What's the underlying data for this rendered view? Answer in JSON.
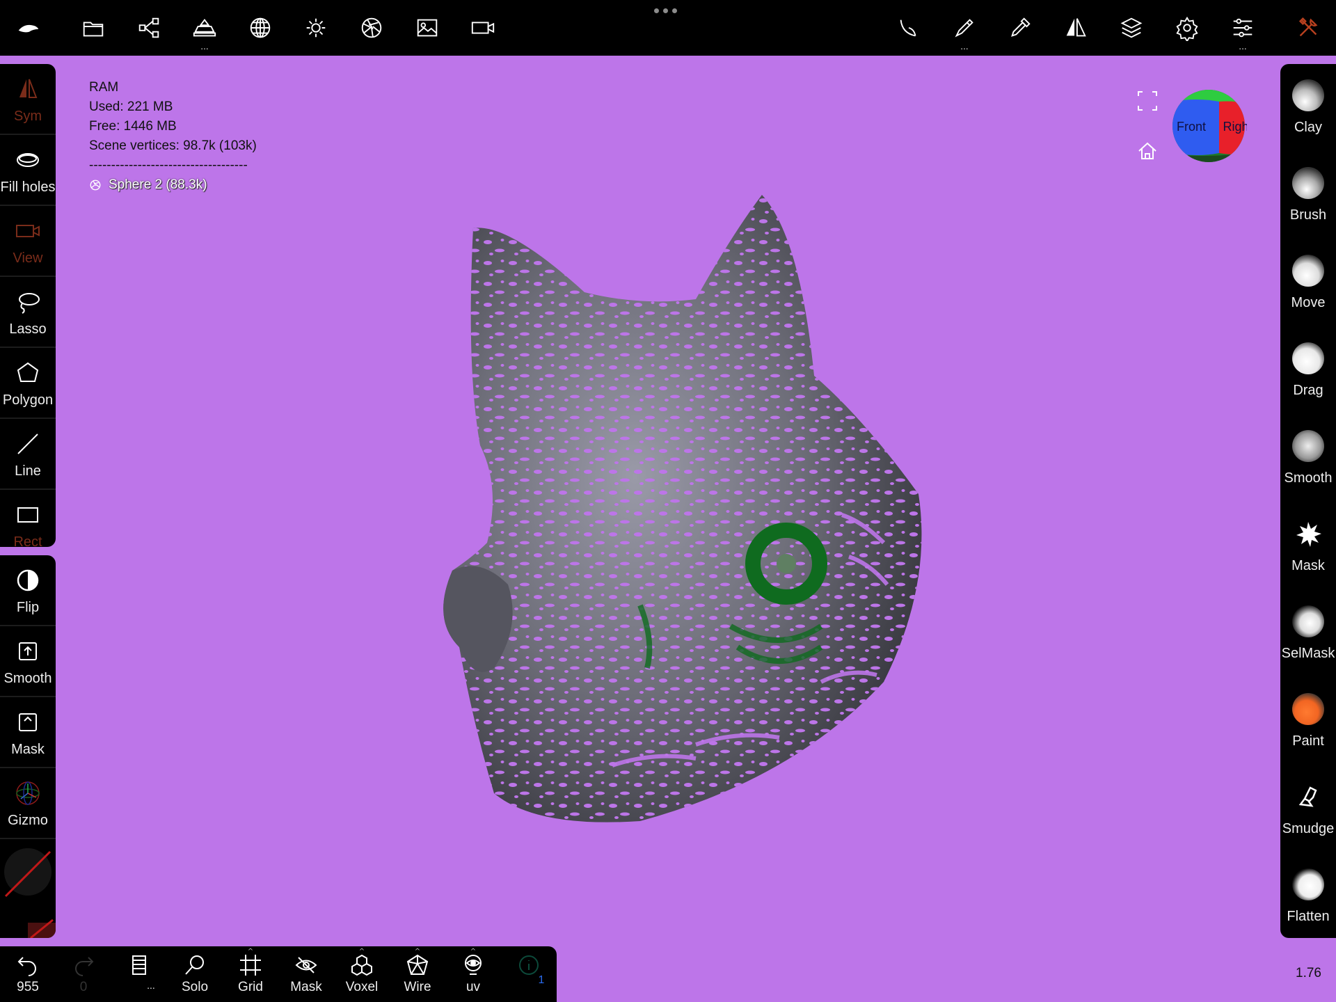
{
  "toolbar": {
    "left_icons": [
      "logo-icon",
      "folder-icon",
      "scene-graph-icon",
      "material-icon",
      "matcap-sphere-icon",
      "light-icon",
      "lens-icon",
      "image-icon",
      "camera-icon"
    ],
    "right_icons": [
      "stroke-icon",
      "brush-settings-icon",
      "picker-icon",
      "symmetry-icon",
      "layers-icon",
      "settings-icon",
      "sliders-icon",
      "tools-icon"
    ],
    "more_label": "..."
  },
  "left_tools": [
    {
      "label": "Sym",
      "icon": "symmetry-icon",
      "enabled": false
    },
    {
      "label": "Fill holes",
      "icon": "fill-holes-icon",
      "enabled": true
    },
    {
      "label": "View",
      "icon": "camera-icon",
      "enabled": false
    },
    {
      "label": "Lasso",
      "icon": "lasso-icon",
      "enabled": true
    },
    {
      "label": "Polygon",
      "icon": "polygon-icon",
      "enabled": true
    },
    {
      "label": "Line",
      "icon": "line-icon",
      "enabled": true
    },
    {
      "label": "Rect",
      "icon": "rect-icon",
      "enabled": false
    }
  ],
  "left_tools2": [
    {
      "label": "Flip",
      "icon": "flip-icon"
    },
    {
      "label": "Smooth",
      "icon": "smooth-mask-icon"
    },
    {
      "label": "Mask",
      "icon": "mask-icon"
    },
    {
      "label": "Gizmo",
      "icon": "gizmo-icon"
    }
  ],
  "right_tools": [
    {
      "label": "Clay",
      "color": "#d9d9d9"
    },
    {
      "label": "Brush",
      "color": "#d9d9d9"
    },
    {
      "label": "Move",
      "color": "#e6e6e6"
    },
    {
      "label": "Drag",
      "color": "#e6e6e6"
    },
    {
      "label": "Smooth",
      "color": "#cccccc"
    },
    {
      "label": "Mask",
      "color": "#ffffff"
    },
    {
      "label": "SelMask",
      "color": "#e0e0e0"
    },
    {
      "label": "Paint",
      "color": "#f26522"
    },
    {
      "label": "Smudge",
      "color": "#ffffff"
    },
    {
      "label": "Flatten",
      "color": "#e6e6e6"
    }
  ],
  "bottom_tools": [
    {
      "label": "955",
      "icon": "undo-icon"
    },
    {
      "label": "0",
      "icon": "redo-icon"
    },
    {
      "label": "...",
      "icon": "book-icon"
    },
    {
      "label": "Solo",
      "icon": "magnifier-icon"
    },
    {
      "label": "Grid",
      "icon": "grid-icon"
    },
    {
      "label": "Mask",
      "icon": "eye-off-icon"
    },
    {
      "label": "Voxel",
      "icon": "voxel-icon"
    },
    {
      "label": "Wire",
      "icon": "wire-icon"
    },
    {
      "label": "uv",
      "icon": "eye-icon"
    },
    {
      "label": "1",
      "icon": "info-icon"
    }
  ],
  "info": {
    "ram": "RAM",
    "used": "Used: 221 MB",
    "free": "Free: 1446 MB",
    "vertices": "Scene vertices: 98.7k (103k)",
    "separator": "------------------------------------",
    "mesh": "Sphere 2 (88.3k)"
  },
  "viewcube": {
    "front": "Front",
    "right": "Righ"
  },
  "zoom": "1.76",
  "colors": {
    "background": "#bd75e9",
    "bar": "#000000",
    "accent": "#f26522"
  }
}
